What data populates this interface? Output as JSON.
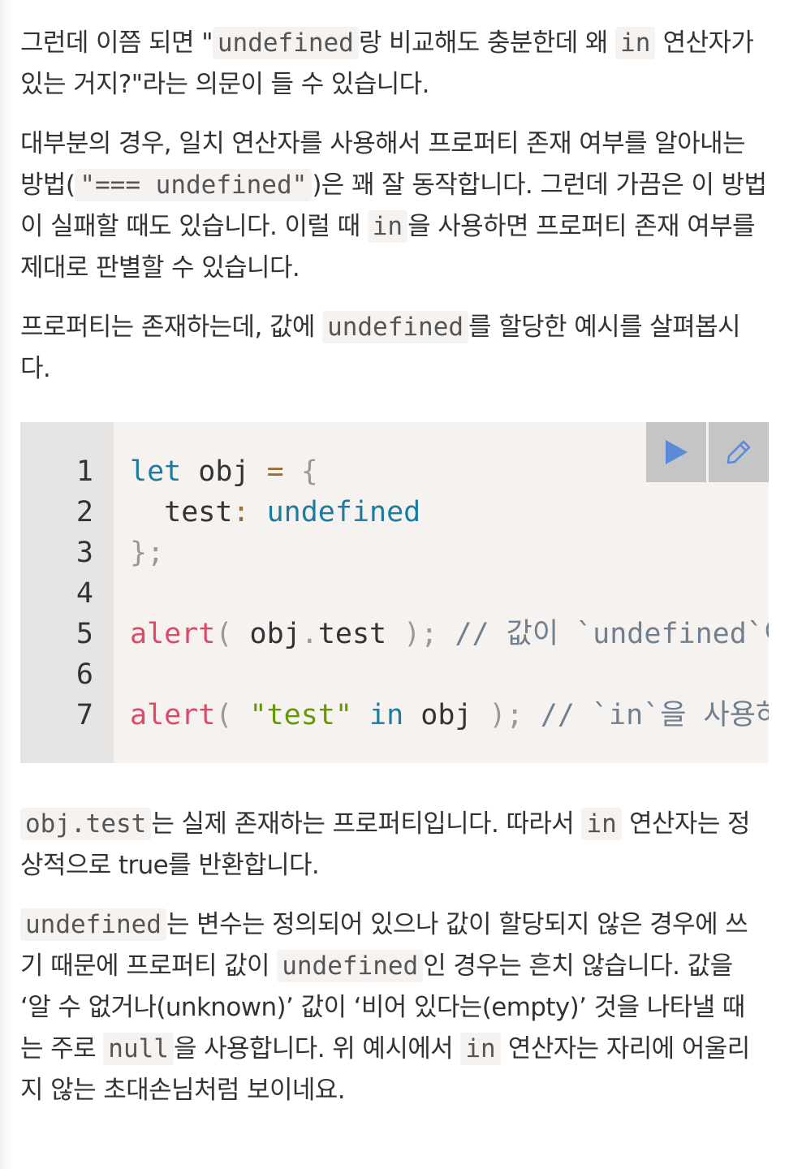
{
  "para1": {
    "t1": "그런데 이쯤 되면 \"",
    "c1": "undefined",
    "t2": "랑 비교해도 충분한데 왜 ",
    "c2": "in",
    "t3": " 연산자가 있는 거지?\"라는 의문이 들 수 있습니다."
  },
  "para2": {
    "t1": "대부분의 경우, 일치 연산자를 사용해서 프로퍼티 존재 여부를 알아내는 방법(",
    "c1": "\"=== undefined\"",
    "t2": ")은 꽤 잘 동작합니다. 그런데 가끔은 이 방법이 실패할 때도 있습니다. 이럴 때 ",
    "c2": "in",
    "t3": "을 사용하면 프로퍼티 존재 여부를 제대로 판별할 수 있습니다."
  },
  "para3": {
    "t1": "프로퍼티는 존재하는데, 값에 ",
    "c1": "undefined",
    "t2": "를 할당한 예시를 살펴봅시다."
  },
  "code": {
    "line_numbers": [
      "1",
      "2",
      "3",
      "4",
      "5",
      "6",
      "7"
    ],
    "l1_kw": "let",
    "l1_rest": " obj ",
    "l1_op": "=",
    "l1_brace": " {",
    "l2_prop": "  test",
    "l2_colon": ":",
    "l2_val": " undefined",
    "l3": "};",
    "l5_fn": "alert",
    "l5_open": "(",
    "l5_mid": " obj",
    "l5_dot": ".",
    "l5_prop": "test ",
    "l5_close": ");",
    "l5_comment": " // 값이 `undefined`이므로, 얼럿 창엔 undefined가 출력됩니다. 그런데 프로퍼티는 존재합니다.",
    "l7_fn": "alert",
    "l7_open": "(",
    "l7_str": " \"test\"",
    "l7_in": " in",
    "l7_obj": " obj ",
    "l7_close": ");",
    "l7_comment": " // `in`을 사용하면 프로퍼티 유무를 제대로 확인할 수 있습니다(true가 출력됨)."
  },
  "toolbar": {
    "run_icon": "play-icon",
    "edit_icon": "pencil-icon",
    "icon_color": "#5b8bd6",
    "button_bg": "#c5c5c5"
  },
  "para4": {
    "c1": "obj.test",
    "t1": "는 실제 존재하는 프로퍼티입니다. 따라서 ",
    "c2": "in",
    "t2": " 연산자는 정상적으로 true를 반환합니다."
  },
  "para5": {
    "c1": "undefined",
    "t1": "는 변수는 정의되어 있으나 값이 할당되지 않은 경우에 쓰기 때문에 프로퍼티 값이 ",
    "c2": "undefined",
    "t2": "인 경우는 흔치 않습니다. 값을 ‘알 수 없거나(unknown)’ 값이 ‘비어 있다는(empty)’ 것을 나타낼 때는 주로 ",
    "c3": "null",
    "t3": "을 사용합니다. 위 예시에서 ",
    "c4": "in",
    "t4": " 연산자는 자리에 어울리지 않는 초대손님처럼 보이네요."
  }
}
